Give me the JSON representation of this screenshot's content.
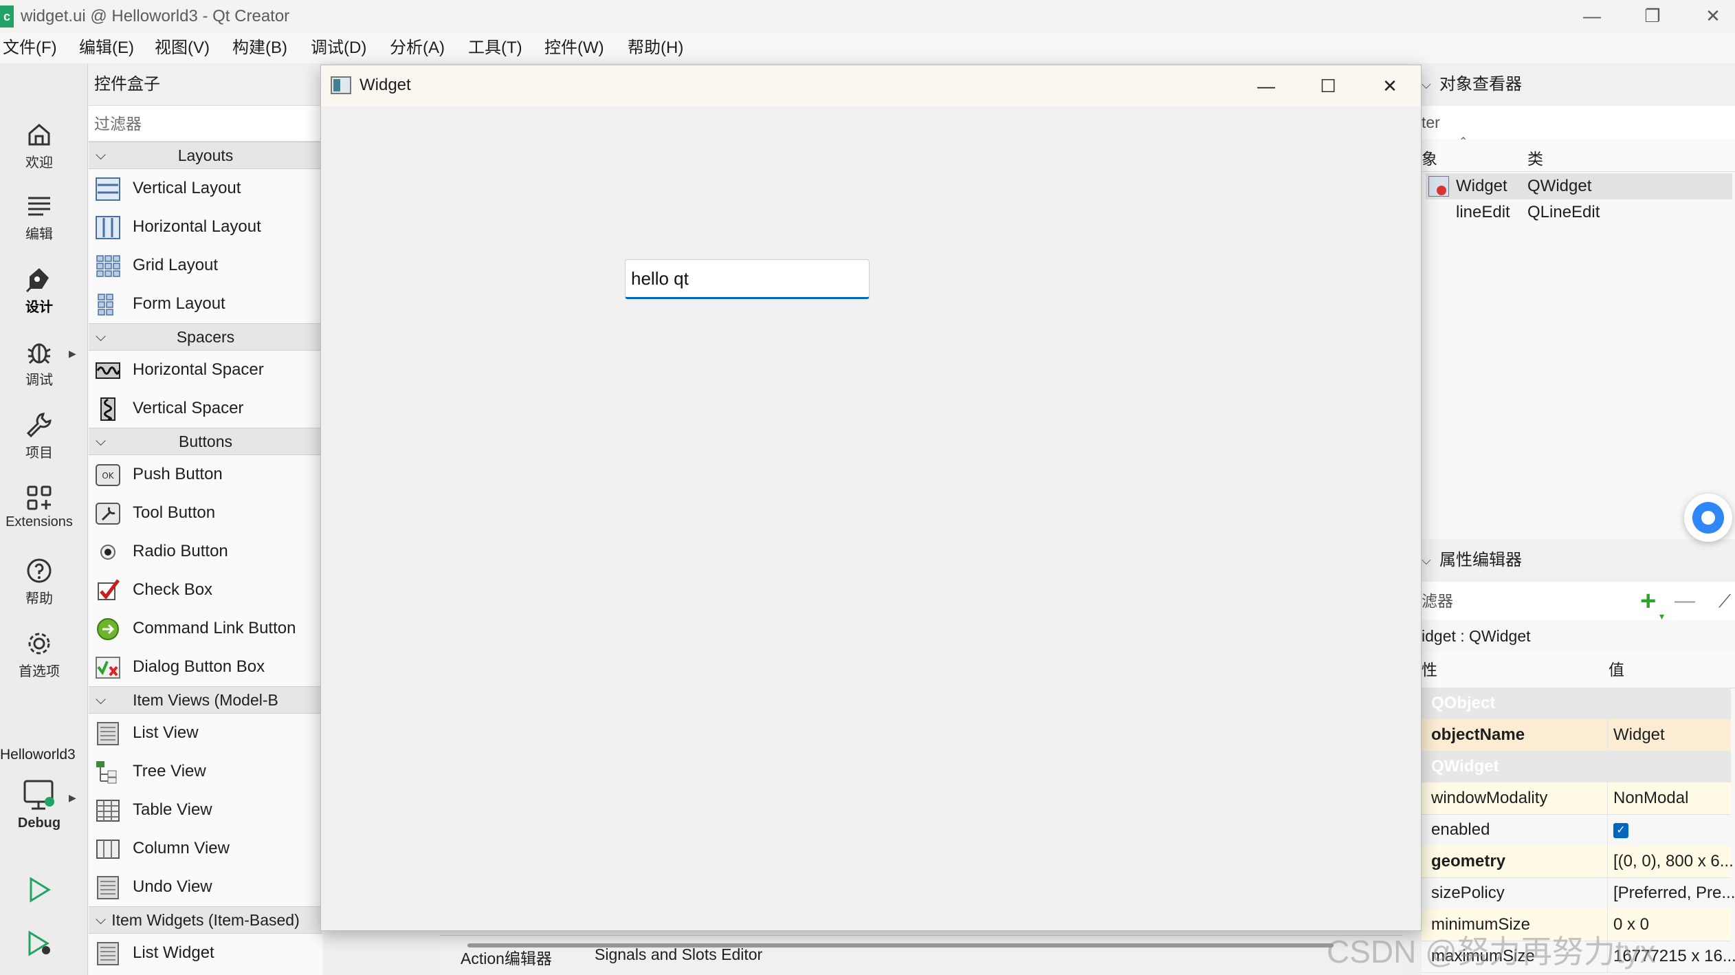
{
  "window": {
    "title": "widget.ui @ Helloworld3 - Qt Creator",
    "app_icon_text": "c",
    "min_glyph": "—",
    "restore_glyph": "❐",
    "close_glyph": "✕"
  },
  "menu": [
    "文件(F)",
    "编辑(E)",
    "视图(V)",
    "构建(B)",
    "调试(D)",
    "分析(A)",
    "工具(T)",
    "控件(W)",
    "帮助(H)"
  ],
  "modes": [
    {
      "label": "欢迎",
      "icon": "home-icon"
    },
    {
      "label": "编辑",
      "icon": "edit-lines-icon"
    },
    {
      "label": "设计",
      "icon": "design-pen-icon",
      "active": true
    },
    {
      "label": "调试",
      "icon": "bug-icon"
    },
    {
      "label": "项目",
      "icon": "wrench-icon"
    },
    {
      "label": "Extensions",
      "icon": "extensions-icon"
    },
    {
      "label": "帮助",
      "icon": "help-icon"
    },
    {
      "label": "首选项",
      "icon": "gear-icon"
    }
  ],
  "project": {
    "name": "Helloworld3",
    "config": "Debug"
  },
  "widget_box": {
    "title": "控件盒子",
    "filter_placeholder": "过滤器",
    "categories": [
      {
        "name": "Layouts",
        "items": [
          {
            "label": "Vertical Layout",
            "icon": "vertical-layout-icon"
          },
          {
            "label": "Horizontal Layout",
            "icon": "horizontal-layout-icon"
          },
          {
            "label": "Grid Layout",
            "icon": "grid-layout-icon"
          },
          {
            "label": "Form Layout",
            "icon": "form-layout-icon"
          }
        ]
      },
      {
        "name": "Spacers",
        "items": [
          {
            "label": "Horizontal Spacer",
            "icon": "horizontal-spacer-icon"
          },
          {
            "label": "Vertical Spacer",
            "icon": "vertical-spacer-icon"
          }
        ]
      },
      {
        "name": "Buttons",
        "items": [
          {
            "label": "Push Button",
            "icon": "push-button-icon"
          },
          {
            "label": "Tool Button",
            "icon": "tool-button-icon"
          },
          {
            "label": "Radio Button",
            "icon": "radio-button-icon"
          },
          {
            "label": "Check Box",
            "icon": "check-box-icon"
          },
          {
            "label": "Command Link Button",
            "icon": "command-link-icon"
          },
          {
            "label": "Dialog Button Box",
            "icon": "dialog-button-box-icon"
          }
        ]
      },
      {
        "name": "Item Views (Model-B",
        "items": [
          {
            "label": "List View",
            "icon": "list-view-icon"
          },
          {
            "label": "Tree View",
            "icon": "tree-view-icon"
          },
          {
            "label": "Table View",
            "icon": "table-view-icon"
          },
          {
            "label": "Column View",
            "icon": "column-view-icon"
          },
          {
            "label": "Undo View",
            "icon": "undo-view-icon"
          }
        ]
      },
      {
        "name": "Item Widgets (Item-Based)",
        "items": [
          {
            "label": "List Widget",
            "icon": "list-widget-icon"
          }
        ]
      }
    ]
  },
  "bottom_tabs": [
    "Action编辑器",
    "Signals and Slots Editor"
  ],
  "preview": {
    "title": "Widget",
    "min_glyph": "—",
    "max_glyph": "☐",
    "close_glyph": "✕",
    "line_edit_value": "hello qt"
  },
  "object_inspector": {
    "title": "对象查看器",
    "filter_text": "ter",
    "col_object": "象",
    "col_class": "类",
    "rows": [
      {
        "object": "Widget",
        "class": "QWidget",
        "selected": true
      },
      {
        "object": "lineEdit",
        "class": "QLineEdit",
        "selected": false
      }
    ]
  },
  "property_editor": {
    "title": "属性编辑器",
    "filter_text": "滤器",
    "context": "idget : QWidget",
    "col_property": "性",
    "col_value": "值",
    "rows": [
      {
        "key": "QObject",
        "value": "",
        "type": "group"
      },
      {
        "key": "objectName",
        "value": "Widget",
        "type": "hl",
        "bold": true
      },
      {
        "key": "QWidget",
        "value": "",
        "type": "group"
      },
      {
        "key": "windowModality",
        "value": "NonModal",
        "type": "yellow"
      },
      {
        "key": "enabled",
        "value": "checked",
        "type": "plain",
        "checkbox": true
      },
      {
        "key": "geometry",
        "value": "[(0, 0), 800 x 6...",
        "type": "yellow",
        "bold": true
      },
      {
        "key": "sizePolicy",
        "value": "[Preferred, Pre...",
        "type": "plain"
      },
      {
        "key": "minimumSize",
        "value": "0 x 0",
        "type": "yellow"
      },
      {
        "key": "maximumSize",
        "value": "16777215 x 16...",
        "type": "plain"
      }
    ]
  },
  "watermark": "CSDN @努力再努力tyx",
  "colors": {
    "accent": "#0067c0",
    "add_green": "#2aa52a",
    "active_tab": "#21a366"
  }
}
